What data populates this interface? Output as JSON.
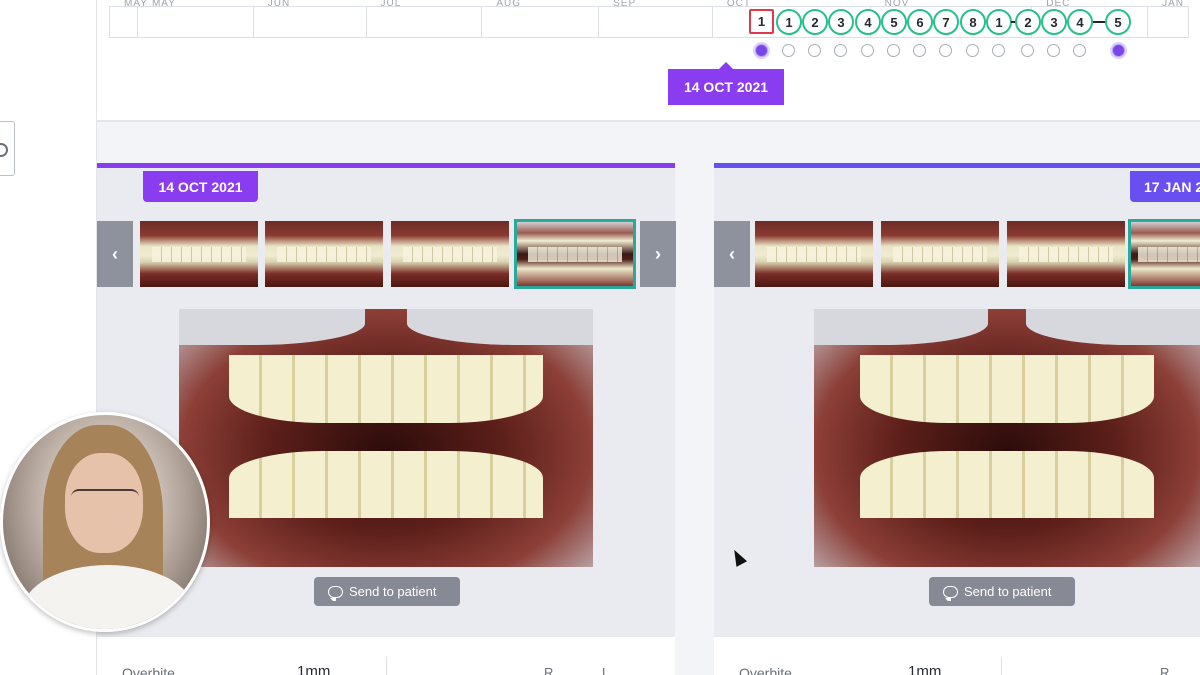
{
  "timeline": {
    "months": [
      "MAY",
      "MAY",
      "JUN",
      "JUL",
      "AUG",
      "SEP",
      "OCT",
      "NOV",
      "DEC",
      "JAN"
    ],
    "steps": [
      "1",
      "1",
      "2",
      "3",
      "4",
      "5",
      "6",
      "7",
      "8",
      "1",
      "2",
      "3",
      "4",
      "5"
    ],
    "current_step_index": 0,
    "selected_date": "14 OCT 2021"
  },
  "panels": {
    "left": {
      "date": "14 OCT 2021",
      "send_label": "Send to patient",
      "metric_label": "Overbite",
      "metric_value": "1mm",
      "side_r": "R",
      "side_l": "L"
    },
    "right": {
      "date": "17 JAN 2",
      "send_label": "Send to patient",
      "metric_label": "Overbite",
      "metric_value": "1mm",
      "side_r": "R"
    }
  },
  "colors": {
    "accent_purple": "#8a3cf0",
    "accent_indigo": "#6a4ff0",
    "step_green": "#27c08a",
    "current_red": "#e0394c",
    "selected_teal": "#2aa89a"
  }
}
